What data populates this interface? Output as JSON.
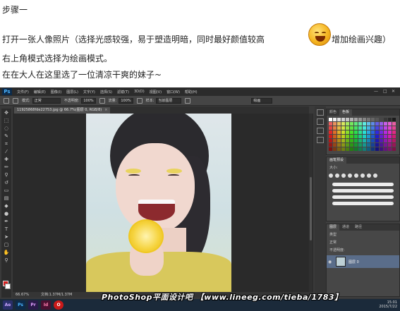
{
  "article": {
    "line1": "步骤一",
    "line2": "打开一张人像照片（选择光感较强，易于塑造明暗，同时最好颜值较高",
    "line2_tail": "增加绘画兴趣）",
    "line3": "右上角模式选择为绘画模式。",
    "line4": "在在大人在这里选了一位清凉干爽的妹子~",
    "emoji_icon": "smiley-emoji-icon"
  },
  "photoshop": {
    "logo": "Ps",
    "menu": [
      "文件(F)",
      "编辑(E)",
      "图像(I)",
      "图层(L)",
      "文字(Y)",
      "选择(S)",
      "滤镜(T)",
      "3D(D)",
      "视图(V)",
      "窗口(W)",
      "帮助(H)"
    ],
    "options": {
      "mode_label": "模式:",
      "mode_value": "正常",
      "opacity_label": "不透明度:",
      "opacity_value": "100%",
      "flow_label": "流量:",
      "flow_value": "100%",
      "sample_label": "样本:",
      "sample_value": "当前图层",
      "workspace": "绘画"
    },
    "doc_tab": "11925868fde22753.jpg @ 66.7%(图层 0, RGB/8)",
    "status": {
      "zoom": "66.67%",
      "doc": "文档:1.37M/1.37M"
    },
    "panels": {
      "swatches_tabs": [
        "颜色",
        "色板"
      ],
      "brush_tabs": [
        "画笔预设"
      ],
      "brush_size_label": "大小:",
      "layers_tabs": [
        "图层",
        "通道",
        "路径"
      ],
      "layer_kind": "类型",
      "blend_mode": "正常",
      "opacity_label": "不透明度:",
      "layer_name": "图层 0"
    },
    "taskbar": [
      "Ae",
      "Ps",
      "Pr",
      "Id",
      "O"
    ],
    "watermark": "PhotoShop平面设计吧 【www.lineeg.com/tieba/1783】",
    "clock_time": "15:01",
    "clock_date": "2015/7/22"
  },
  "colors": {
    "ps_bg": "#3a3a3a",
    "accent_blue": "#4ab3ff",
    "foreground": "#d62020",
    "background": "#ffffff"
  }
}
